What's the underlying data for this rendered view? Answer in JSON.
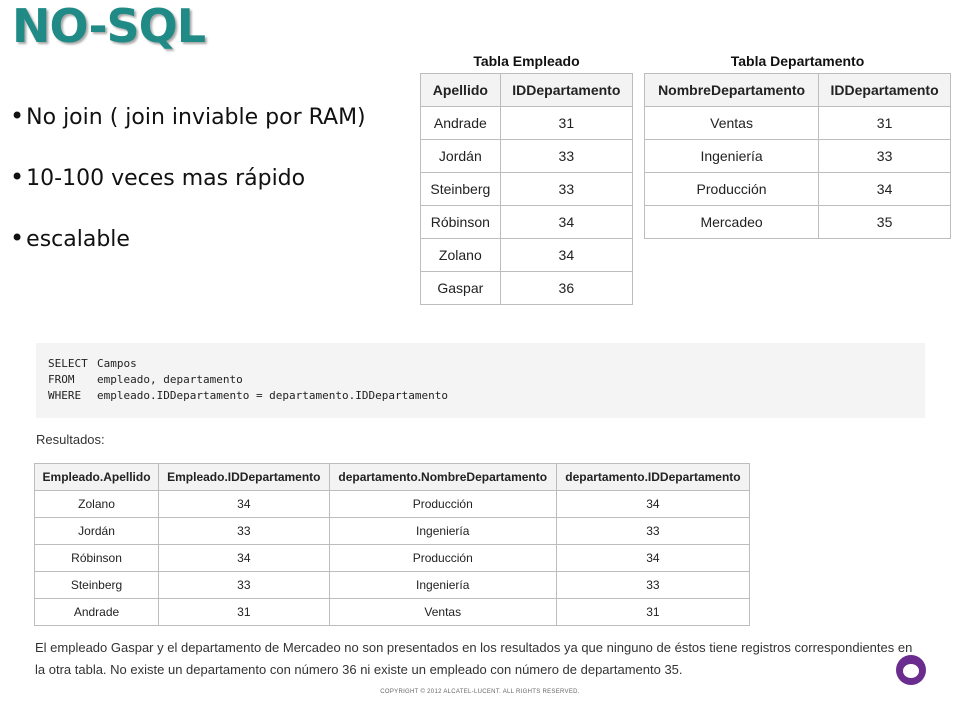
{
  "slide": {
    "title": "NO-SQL",
    "bullets": [
      "No join ( join inviable por RAM)",
      "10-100 veces mas rápido",
      "escalable"
    ]
  },
  "empleado": {
    "caption": "Tabla Empleado",
    "headers": [
      "Apellido",
      "IDDepartamento"
    ],
    "rows": [
      [
        "Andrade",
        "31"
      ],
      [
        "Jordán",
        "33"
      ],
      [
        "Steinberg",
        "33"
      ],
      [
        "Róbinson",
        "34"
      ],
      [
        "Zolano",
        "34"
      ],
      [
        "Gaspar",
        "36"
      ]
    ]
  },
  "departamento": {
    "caption": "Tabla Departamento",
    "headers": [
      "NombreDepartamento",
      "IDDepartamento"
    ],
    "rows": [
      [
        "Ventas",
        "31"
      ],
      [
        "Ingeniería",
        "33"
      ],
      [
        "Producción",
        "34"
      ],
      [
        "Mercadeo",
        "35"
      ]
    ]
  },
  "query": {
    "lines": [
      {
        "keyword": "SELECT",
        "text": "Campos"
      },
      {
        "keyword": "FROM",
        "text": "empleado, departamento"
      },
      {
        "keyword": "WHERE",
        "text": "empleado.IDDepartamento = departamento.IDDepartamento"
      }
    ]
  },
  "results": {
    "label": "Resultados:",
    "headers": [
      "Empleado.Apellido",
      "Empleado.IDDepartamento",
      "departamento.NombreDepartamento",
      "departamento.IDDepartamento"
    ],
    "rows": [
      [
        "Zolano",
        "34",
        "Producción",
        "34"
      ],
      [
        "Jordán",
        "33",
        "Ingeniería",
        "33"
      ],
      [
        "Róbinson",
        "34",
        "Producción",
        "34"
      ],
      [
        "Steinberg",
        "33",
        "Ingeniería",
        "33"
      ],
      [
        "Andrade",
        "31",
        "Ventas",
        "31"
      ]
    ]
  },
  "note": "El empleado Gaspar y el departamento de Mercadeo no son presentados en los resultados ya que ninguno de éstos tiene registros correspondientes en la otra tabla. No existe un departamento con número 36 ni existe un empleado con número de departamento 35.",
  "footer": "COPYRIGHT © 2012 ALCATEL-LUCENT.  ALL RIGHTS RESERVED.",
  "logo_icon": "alcatel-lucent-logo-icon"
}
